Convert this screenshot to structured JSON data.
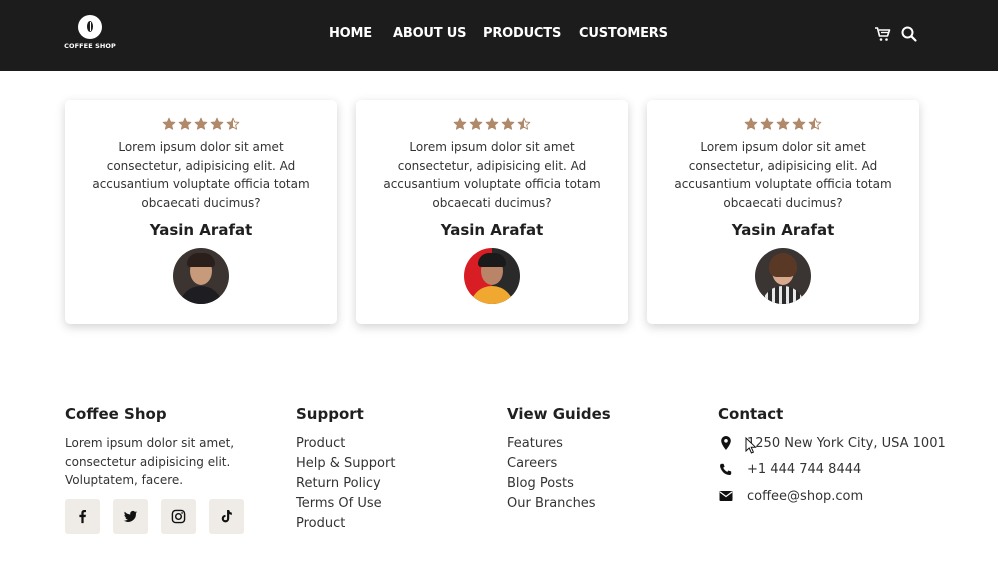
{
  "brand": {
    "logo_text": "COFFEE SHOP"
  },
  "nav": {
    "items": [
      {
        "label": "HOME"
      },
      {
        "label": "ABOUT US"
      },
      {
        "label": "PRODUCTS"
      },
      {
        "label": "CUSTOMERS"
      }
    ],
    "icons": [
      "cart-icon",
      "search-icon"
    ]
  },
  "testimonials": [
    {
      "rating": 4.5,
      "text": "Lorem ipsum dolor sit amet consectetur, adipisicing elit. Ad accusantium voluptate officia totam obcaecati ducimus?",
      "name": "Yasin Arafat",
      "avatar": "young-man-avatar"
    },
    {
      "rating": 4.5,
      "text": "Lorem ipsum dolor sit amet consectetur, adipisicing elit. Ad accusantium voluptate officia totam obcaecati ducimus?",
      "name": "Yasin Arafat",
      "avatar": "man-with-cap-avatar"
    },
    {
      "rating": 4.5,
      "text": "Lorem ipsum dolor sit amet consectetur, adipisicing elit. Ad accusantium voluptate officia totam obcaecati ducimus?",
      "name": "Yasin Arafat",
      "avatar": "woman-avatar"
    }
  ],
  "footer": {
    "about": {
      "title": "Coffee Shop",
      "description": "Lorem ipsum dolor sit amet, consectetur adipisicing elit. Voluptatem, facere.",
      "socials": [
        "facebook-icon",
        "twitter-icon",
        "instagram-icon",
        "tiktok-icon"
      ]
    },
    "support": {
      "title": "Support",
      "links": [
        "Product",
        "Help & Support",
        "Return Policy",
        "Terms Of Use",
        "Product"
      ]
    },
    "guides": {
      "title": "View Guides",
      "links": [
        "Features",
        "Careers",
        "Blog Posts",
        "Our Branches"
      ]
    },
    "contact": {
      "title": "Contact",
      "address": "1250 New York City, USA 1001",
      "phone": "+1 444 744 8444",
      "email": "coffee@shop.com"
    }
  },
  "colors": {
    "header_bg": "#1c1c1c",
    "star": "#b0896a",
    "social_bg": "#efece8"
  }
}
